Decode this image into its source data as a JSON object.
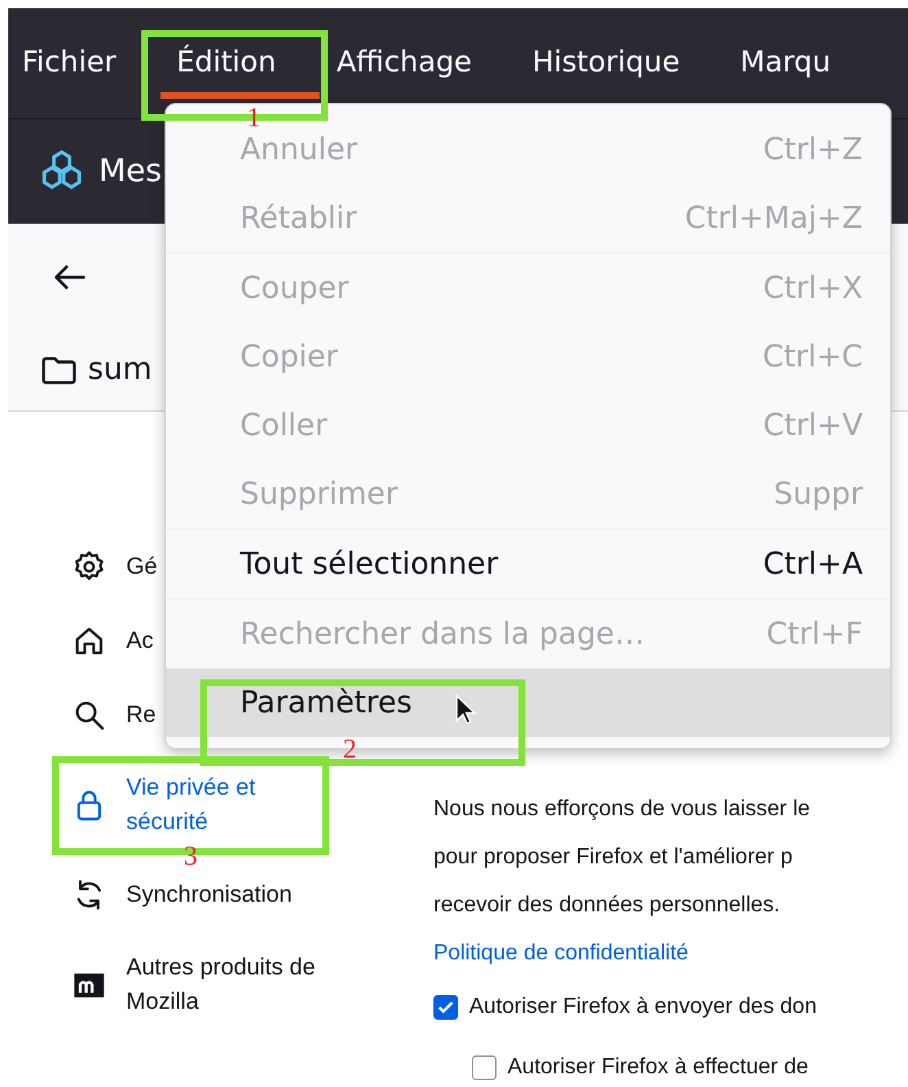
{
  "menubar": [
    {
      "label": "Fichier"
    },
    {
      "label": "Édition"
    },
    {
      "label": "Affichage"
    },
    {
      "label": "Historique"
    },
    {
      "label": "Marqu"
    }
  ],
  "tab": {
    "label": "Mes"
  },
  "bookmark": {
    "label": "sum"
  },
  "sidebar": {
    "items": [
      {
        "label": "Gé",
        "selected": false
      },
      {
        "label": "Ac",
        "selected": false
      },
      {
        "label": "Re",
        "selected": false
      },
      {
        "label": "Vie privée et sécurité",
        "selected": true
      },
      {
        "label": "Synchronisation",
        "selected": false
      },
      {
        "label": "Autres produits de Mozilla",
        "selected": false
      }
    ]
  },
  "content": {
    "paragraph_lines": [
      "Nous nous efforçons de vous laisser le",
      "pour proposer Firefox et l'améliorer p",
      "recevoir des données personnelles."
    ],
    "link": "Politique de confidentialité",
    "checkboxes": [
      {
        "label": "Autoriser Firefox à envoyer des don",
        "checked": true,
        "nested": false
      },
      {
        "label": "Autoriser Firefox à effectuer de",
        "checked": false,
        "nested": true
      }
    ]
  },
  "menu": {
    "items": [
      {
        "kind": "item",
        "label": "Annuler",
        "shortcut": "Ctrl+Z",
        "disabled": true,
        "selected": false
      },
      {
        "kind": "item",
        "label": "Rétablir",
        "shortcut": "Ctrl+Maj+Z",
        "disabled": true,
        "selected": false
      },
      {
        "kind": "separator"
      },
      {
        "kind": "item",
        "label": "Couper",
        "shortcut": "Ctrl+X",
        "disabled": true,
        "selected": false
      },
      {
        "kind": "item",
        "label": "Copier",
        "shortcut": "Ctrl+C",
        "disabled": true,
        "selected": false
      },
      {
        "kind": "item",
        "label": "Coller",
        "shortcut": "Ctrl+V",
        "disabled": true,
        "selected": false
      },
      {
        "kind": "item",
        "label": "Supprimer",
        "shortcut": "Suppr",
        "disabled": true,
        "selected": false
      },
      {
        "kind": "separator"
      },
      {
        "kind": "item",
        "label": "Tout sélectionner",
        "shortcut": "Ctrl+A",
        "disabled": false,
        "selected": false
      },
      {
        "kind": "separator"
      },
      {
        "kind": "item",
        "label": "Rechercher dans la page…",
        "shortcut": "Ctrl+F",
        "disabled": true,
        "selected": false
      },
      {
        "kind": "item",
        "label": "Paramètres",
        "disabled": false,
        "selected": true
      }
    ]
  },
  "annotations": [
    {
      "label": "1"
    },
    {
      "label": "2"
    },
    {
      "label": "3"
    }
  ]
}
